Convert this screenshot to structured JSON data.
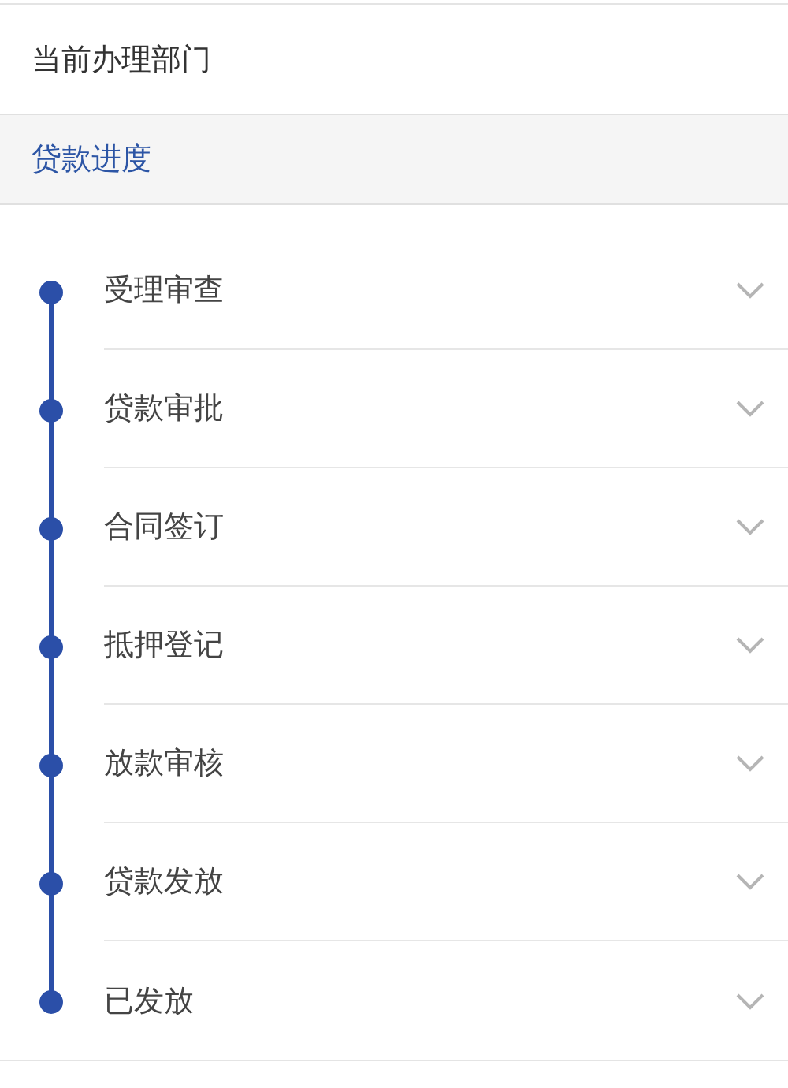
{
  "department_row": {
    "label": "当前办理部门"
  },
  "section": {
    "title": "贷款进度"
  },
  "steps": [
    {
      "label": "受理审查",
      "expanded": false
    },
    {
      "label": "贷款审批",
      "expanded": false
    },
    {
      "label": "合同签订",
      "expanded": false
    },
    {
      "label": "抵押登记",
      "expanded": false
    },
    {
      "label": "放款审核",
      "expanded": false
    },
    {
      "label": "贷款发放",
      "expanded": false
    },
    {
      "label": "已发放",
      "expanded": false
    }
  ]
}
